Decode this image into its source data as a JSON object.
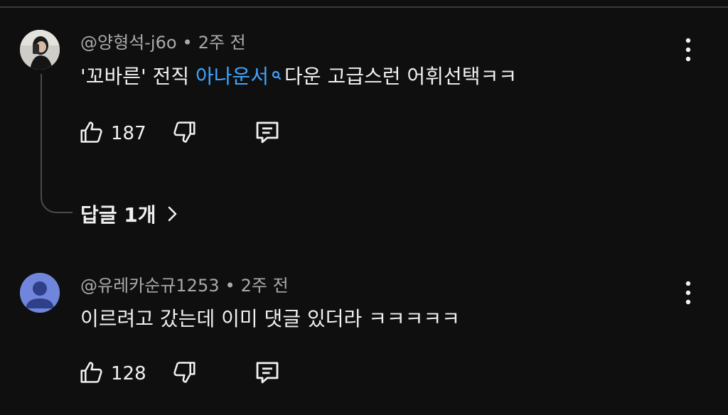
{
  "comments": [
    {
      "author": "@양형석-j6o",
      "time": "2주 전",
      "text_before": "'꼬바른' 전직 ",
      "text_link": "아나운서",
      "text_after": "다운 고급스런 어휘선택ㅋㅋ",
      "likes": "187",
      "replies_label": "답글 1개"
    },
    {
      "author": "@유레카순규1253",
      "time": "2주 전",
      "text": "이르려고 갔는데 이미 댓글 있더라 ㅋㅋㅋㅋㅋ",
      "likes": "128"
    }
  ],
  "separator": "•",
  "colors": {
    "background": "#0f0f0f",
    "text": "#f1f1f1",
    "meta": "#aaaaaa",
    "link": "#3ea6ff",
    "default_avatar": "#6f86dc"
  },
  "icons": [
    "like-icon",
    "dislike-icon",
    "reply-icon",
    "more-icon",
    "search-icon",
    "chevron-right-icon",
    "default-avatar-icon"
  ]
}
